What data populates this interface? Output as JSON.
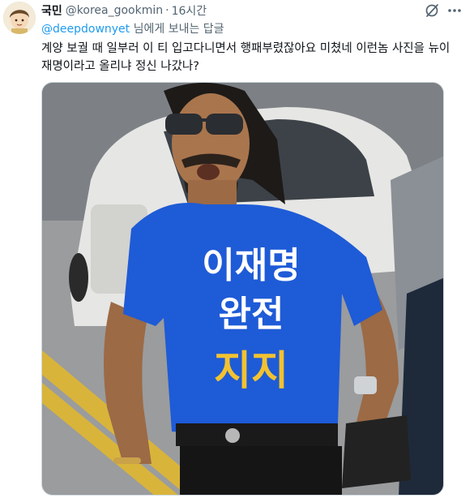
{
  "tweet": {
    "author_name": "국민",
    "author_handle": "@korea_gookmin",
    "separator": "·",
    "time": "16시간",
    "reply_to_handle": "@deepdownyet",
    "reply_suffix": " 님에게 보내는 답글",
    "text": "계양 보궐 때 일부러 이 티 입고다니면서 행패부렸잖아요 미쳤네 이런놈 사진을 뉴이 재명이라고 올리냐 정신 나갔나?"
  },
  "photo": {
    "shirt_lines": [
      "이재명",
      "완전",
      "지지"
    ]
  },
  "icons": {
    "grok": "grok-icon",
    "more": "more-options-icon",
    "avatar": "avatar"
  },
  "colors": {
    "accent": "#1d9bf0",
    "secondary_text": "#536471",
    "shirt_blue": "#1e5bd6",
    "shirt_text_white": "#ffffff",
    "shirt_text_yellow": "#f2c230"
  }
}
